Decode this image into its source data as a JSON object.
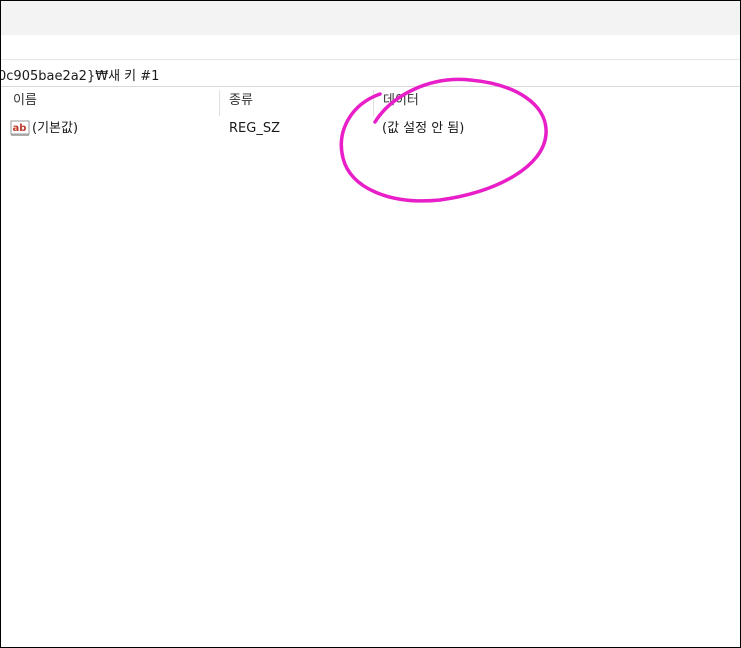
{
  "address": {
    "path": "0c905bae2a2}₩새 키 #1"
  },
  "columns": {
    "name": "이름",
    "type": "종류",
    "data": "데이터"
  },
  "rows": [
    {
      "icon": "string-value-ab-icon",
      "icon_text": "ab",
      "name": "(기본값)",
      "type": "REG_SZ",
      "data": "(값 설정 안 됨)"
    }
  ],
  "colors": {
    "annotation": "#e81ec8",
    "icon_red": "#c0392b"
  }
}
